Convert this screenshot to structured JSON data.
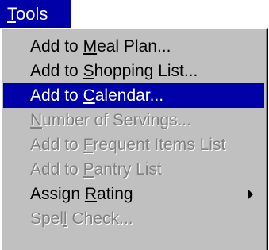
{
  "menu": {
    "title": {
      "before": "",
      "mnemonic": "T",
      "after": "ools"
    },
    "items": [
      {
        "before": "Add to ",
        "mnemonic": "M",
        "after": "eal Plan...",
        "state": "normal"
      },
      {
        "before": "Add to ",
        "mnemonic": "S",
        "after": "hopping List...",
        "state": "normal"
      },
      {
        "before": "Add to ",
        "mnemonic": "C",
        "after": "alendar...",
        "state": "highlighted"
      },
      {
        "before": "",
        "mnemonic": "N",
        "after": "umber of Servings...",
        "state": "disabled"
      },
      {
        "before": "Add to ",
        "mnemonic": "F",
        "after": "requent Items List",
        "state": "disabled"
      },
      {
        "before": "Add to ",
        "mnemonic": "P",
        "after": "antry List",
        "state": "disabled"
      },
      {
        "before": "Assign ",
        "mnemonic": "R",
        "after": "ating",
        "state": "normal",
        "submenu": true
      },
      {
        "before": "Spel",
        "mnemonic": "l",
        "after": " Check...",
        "state": "disabled"
      }
    ]
  },
  "icons": {
    "submenu_arrow": "triangle-right-icon"
  },
  "colors": {
    "highlight": "#0000a8",
    "menu_background": "#c0c0c0",
    "disabled_text": "#808080"
  }
}
